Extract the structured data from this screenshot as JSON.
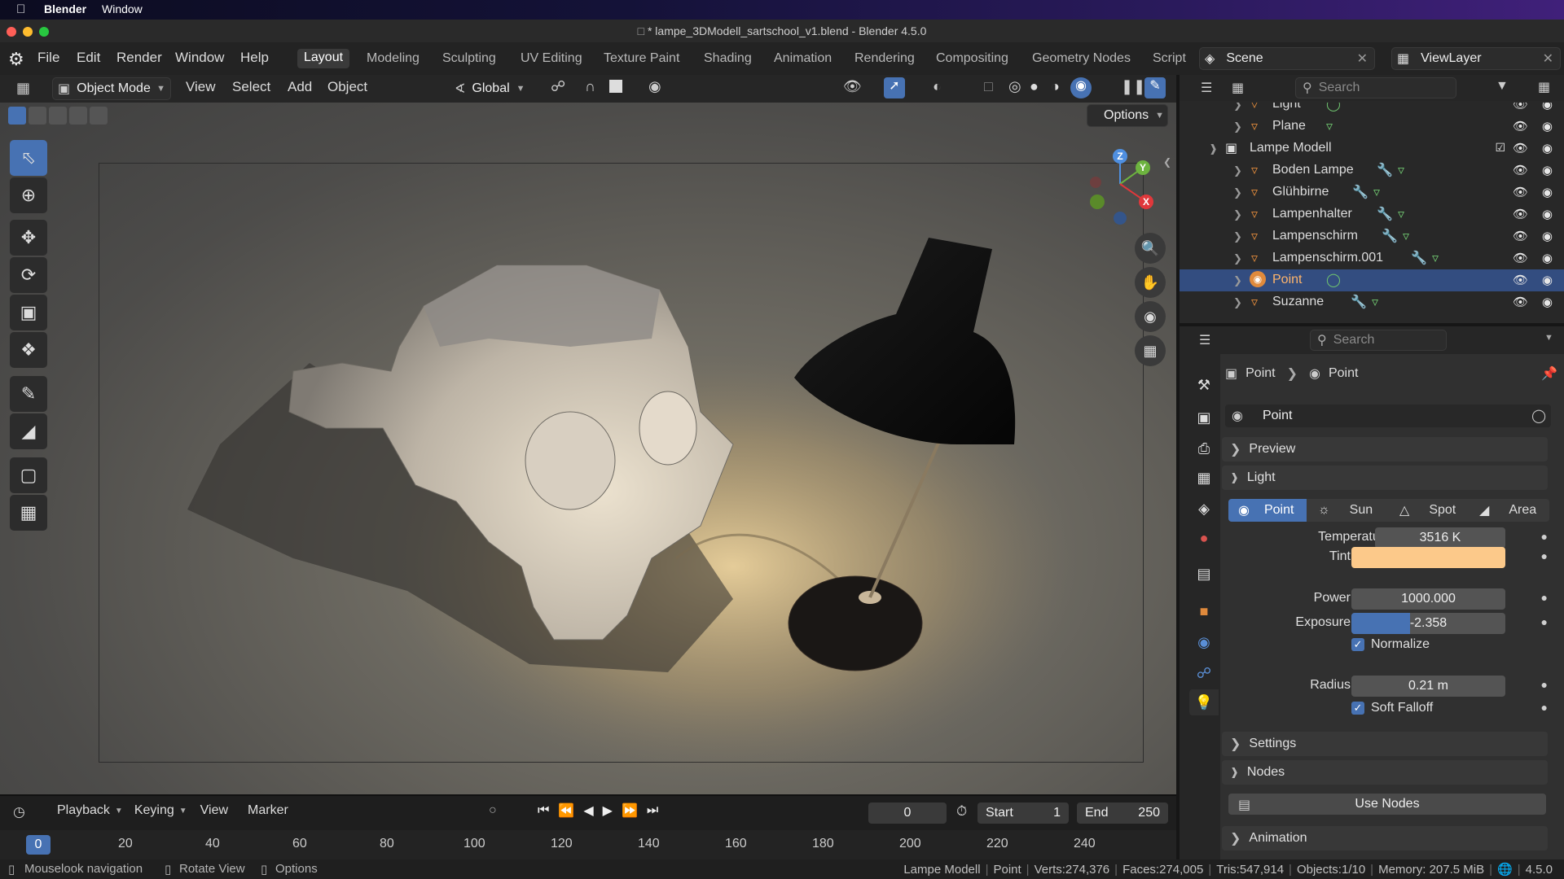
{
  "macos": {
    "app": "Blender",
    "menu_window": "Window"
  },
  "window": {
    "title": "* lampe_3DModell_sartschool_v1.blend - Blender 4.5.0"
  },
  "menubar": {
    "menus": [
      "File",
      "Edit",
      "Render",
      "Window",
      "Help"
    ],
    "workspaces": [
      "Layout",
      "Modeling",
      "Sculpting",
      "UV Editing",
      "Texture Paint",
      "Shading",
      "Animation",
      "Rendering",
      "Compositing",
      "Geometry Nodes",
      "Script"
    ],
    "active_workspace": "Layout",
    "scene": "Scene",
    "view_layer": "ViewLayer"
  },
  "viewport_header": {
    "mode": "Object Mode",
    "menus": [
      "View",
      "Select",
      "Add",
      "Object"
    ],
    "transform_orientation": "Global",
    "options_label": "Options"
  },
  "gizmo": {
    "z": "Z",
    "y": "Y",
    "x": "X"
  },
  "outliner": {
    "search_placeholder": "Search",
    "rows": [
      {
        "name": "Light",
        "indent": 1,
        "type": "object"
      },
      {
        "name": "Plane",
        "indent": 1,
        "type": "mesh"
      },
      {
        "name": "Lampe Modell",
        "indent": 0,
        "type": "collection"
      },
      {
        "name": "Boden Lampe",
        "indent": 1,
        "type": "mesh"
      },
      {
        "name": "Glühbirne",
        "indent": 1,
        "type": "mesh"
      },
      {
        "name": "Lampenhalter",
        "indent": 1,
        "type": "mesh"
      },
      {
        "name": "Lampenschirm",
        "indent": 1,
        "type": "mesh"
      },
      {
        "name": "Lampenschirm.001",
        "indent": 1,
        "type": "mesh"
      },
      {
        "name": "Point",
        "indent": 1,
        "type": "light",
        "selected": true
      },
      {
        "name": "Suzanne",
        "indent": 1,
        "type": "mesh"
      }
    ]
  },
  "properties": {
    "search_placeholder": "Search",
    "breadcrumb": [
      "Point",
      "Point"
    ],
    "datablock": "Point",
    "panels": {
      "preview": "Preview",
      "light": "Light",
      "settings": "Settings",
      "nodes": "Nodes",
      "animation": "Animation"
    },
    "light_types": [
      "Point",
      "Sun",
      "Spot",
      "Area"
    ],
    "active_light_type": "Point",
    "temperature_label": "Temperature",
    "temperature": "3516 K",
    "tint_label": "Tint",
    "tint_color": "#fcc98a",
    "power_label": "Power",
    "power": "1000.000",
    "exposure_label": "Exposure",
    "exposure": "-2.358",
    "exposure_fraction": 0.38,
    "normalize_label": "Normalize",
    "radius_label": "Radius",
    "radius": "0.21 m",
    "soft_falloff_label": "Soft Falloff",
    "use_nodes_label": "Use Nodes"
  },
  "timeline": {
    "menus": [
      "Playback",
      "Keying",
      "View",
      "Marker"
    ],
    "current_frame": "0",
    "start_label": "Start",
    "start": "1",
    "end_label": "End",
    "end": "250",
    "ruler": [
      "0",
      "20",
      "40",
      "60",
      "80",
      "100",
      "120",
      "140",
      "160",
      "180",
      "200",
      "220",
      "240"
    ]
  },
  "statusbar": {
    "left": [
      "Mouselook navigation",
      "Rotate View",
      "Options"
    ],
    "collection": "Lampe Modell",
    "object": "Point",
    "verts": "Verts:274,376",
    "faces": "Faces:274,005",
    "tris": "Tris:547,914",
    "objects": "Objects:1/10",
    "memory": "Memory: 207.5 MiB",
    "version": "4.5.0"
  },
  "colors": {
    "accent": "#4772b3",
    "selection": "#334d80",
    "mesh_icon": "#e08a3c"
  }
}
